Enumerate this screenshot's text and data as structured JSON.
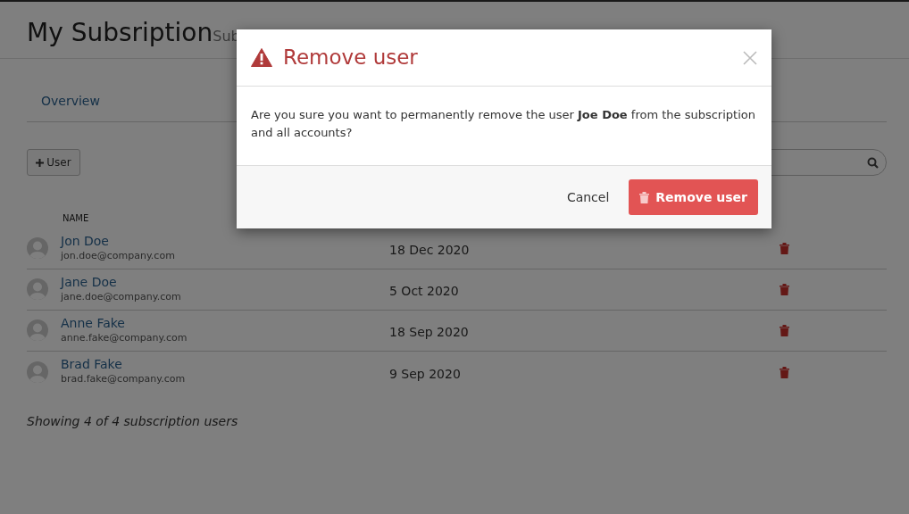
{
  "page": {
    "title": "My Subsription",
    "subtitle": "Sub"
  },
  "tabs": [
    {
      "label": "Overview"
    }
  ],
  "add_button": {
    "label": "User"
  },
  "table": {
    "columns": [
      "NAME"
    ],
    "rows": [
      {
        "name": "Jon Doe",
        "email": "jon.doe@company.com",
        "date": "18 Dec 2020"
      },
      {
        "name": "Jane Doe",
        "email": "jane.doe@company.com",
        "date": "5 Oct 2020"
      },
      {
        "name": "Anne Fake",
        "email": "anne.fake@company.com",
        "date": "18 Sep 2020"
      },
      {
        "name": "Brad Fake",
        "email": "brad.fake@company.com",
        "date": "9 Sep 2020"
      }
    ]
  },
  "summary": "Showing 4 of 4 subscription users",
  "modal": {
    "title": "Remove user",
    "message": "Are you sure you want to permanently remove the user **Joe Doe** from the subscription and all accounts?",
    "cancel": "Cancel",
    "confirm": "Remove user"
  }
}
